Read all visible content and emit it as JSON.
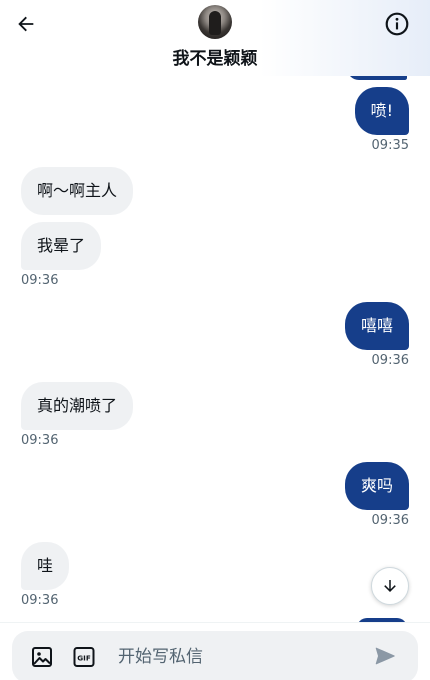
{
  "header": {
    "title": "我不是颖颖",
    "back_icon": "arrow-left-icon",
    "info_icon": "info-circle-icon"
  },
  "messages": [
    {
      "side": "out",
      "text": "喷!",
      "time": "09:35"
    },
    {
      "side": "in",
      "text": "啊～啊主人",
      "time": ""
    },
    {
      "side": "in",
      "text": "我晕了",
      "time": "09:36"
    },
    {
      "side": "out",
      "text": "嘻嘻",
      "time": "09:36"
    },
    {
      "side": "in",
      "text": "真的潮喷了",
      "time": "09:36"
    },
    {
      "side": "out",
      "text": "爽吗",
      "time": "09:36"
    },
    {
      "side": "in",
      "text": "哇",
      "time": "09:36"
    }
  ],
  "composer": {
    "placeholder": "开始写私信",
    "image_icon": "image-icon",
    "gif_label": "GIF",
    "send_icon": "send-icon"
  },
  "colors": {
    "outgoing_bubble": "#163e8a",
    "incoming_bubble": "#eff1f3",
    "timestamp": "#536471"
  }
}
